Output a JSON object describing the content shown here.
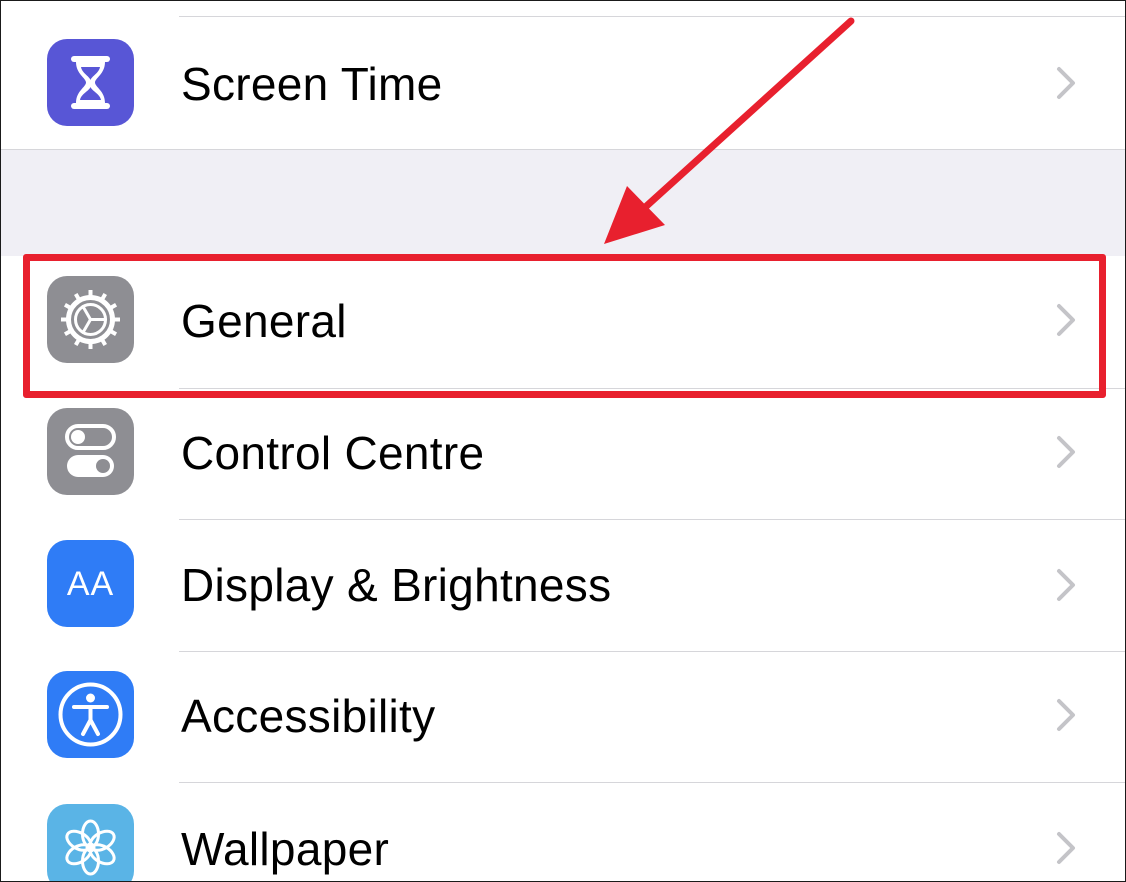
{
  "settings_list": {
    "items": [
      {
        "label": "Screen Time",
        "icon": "hourglass-icon",
        "icon_bg": "#5856d6"
      },
      {
        "label": "General",
        "icon": "gear-icon",
        "icon_bg": "#8e8e93"
      },
      {
        "label": "Control Centre",
        "icon": "toggles-icon",
        "icon_bg": "#8e8e93"
      },
      {
        "label": "Display & Brightness",
        "icon": "text-size-icon",
        "icon_bg": "#2f7cf6",
        "icon_text": "AA"
      },
      {
        "label": "Accessibility",
        "icon": "accessibility-icon",
        "icon_bg": "#2f7cf6"
      },
      {
        "label": "Wallpaper",
        "icon": "flower-icon",
        "icon_bg": "#5ab4e6"
      }
    ]
  },
  "annotation": {
    "highlight_color": "#e8202e",
    "highlighted_item": "General",
    "arrow": "pointing-arrow-icon"
  },
  "colors": {
    "separator": "#d6d6da",
    "group_background": "#f0eff5",
    "chevron": "#c4c4c8"
  }
}
